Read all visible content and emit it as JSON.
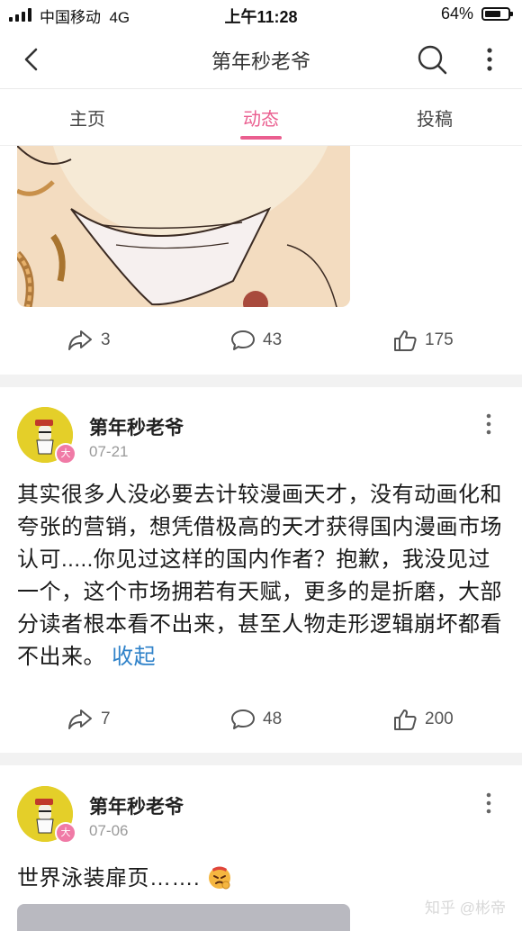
{
  "status_bar": {
    "carrier": "中国移动",
    "network": "4G",
    "time": "上午11:28",
    "battery": "64%",
    "battery_level": 0.64
  },
  "nav": {
    "back_icon": "chevron-left-icon",
    "title": "第年秒老爷",
    "search_icon": "search-icon",
    "more_icon": "more-vertical-icon"
  },
  "tabs": [
    {
      "label": "主页",
      "active": false
    },
    {
      "label": "动态",
      "active": true
    },
    {
      "label": "投稿",
      "active": false
    }
  ],
  "accent_color": "#ea5e8f",
  "link_color": "#2f82c9",
  "posts": [
    {
      "actions": {
        "share": "3",
        "comment": "43",
        "like": "175"
      }
    },
    {
      "author": "第年秒老爷",
      "date": "07-21",
      "badge": "大",
      "content": "其实很多人没必要去计较漫画天才，没有动画化和夸张的营销，想凭借极高的天才获得国内漫画市场认可.....你见过这样的国内作者？抱歉，我没见过一个，这个市场拥若有天赋，更多的是折磨，大部分读者根本看不出来，甚至人物走形逻辑崩坏都看不出来。",
      "collapse": "收起",
      "actions": {
        "share": "7",
        "comment": "48",
        "like": "200"
      }
    },
    {
      "author": "第年秒老爷",
      "date": "07-06",
      "badge": "大",
      "content": "世界泳装扉页……."
    }
  ],
  "watermark": "知乎 @彬帝"
}
